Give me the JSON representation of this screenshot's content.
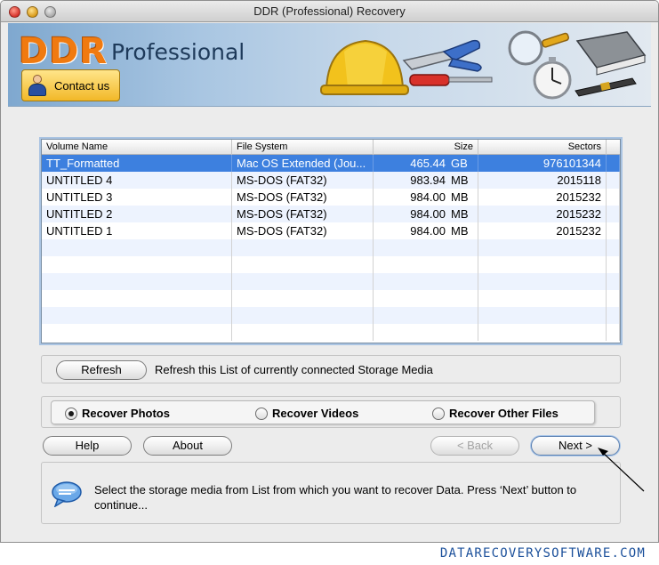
{
  "window": {
    "title": "DDR (Professional) Recovery"
  },
  "header": {
    "logo_main": "DDR",
    "logo_sub": "Professional",
    "contact_label": "Contact us"
  },
  "table": {
    "columns": [
      "Volume Name",
      "File System",
      "Size",
      "Sectors"
    ],
    "rows": [
      {
        "name": "TT_Formatted",
        "fs": "Mac OS Extended (Jou...",
        "size": "465.44",
        "unit": "GB",
        "sectors": "976101344",
        "selected": true
      },
      {
        "name": "UNTITLED 4",
        "fs": "MS-DOS (FAT32)",
        "size": "983.94",
        "unit": "MB",
        "sectors": "2015118"
      },
      {
        "name": "UNTITLED 3",
        "fs": "MS-DOS (FAT32)",
        "size": "984.00",
        "unit": "MB",
        "sectors": "2015232"
      },
      {
        "name": "UNTITLED 2",
        "fs": "MS-DOS (FAT32)",
        "size": "984.00",
        "unit": "MB",
        "sectors": "2015232"
      },
      {
        "name": "UNTITLED 1",
        "fs": "MS-DOS (FAT32)",
        "size": "984.00",
        "unit": "MB",
        "sectors": "2015232"
      }
    ]
  },
  "refresh": {
    "button_label": "Refresh",
    "description": "Refresh this List of currently connected Storage Media"
  },
  "recovery_mode": {
    "options": [
      "Recover Photos",
      "Recover Videos",
      "Recover Other Files"
    ],
    "selected": "Recover Photos"
  },
  "buttons": {
    "help": "Help",
    "about": "About",
    "back": "< Back",
    "next": "Next >"
  },
  "info": {
    "message": "Select the storage media from List from which you want to recover Data. Press ‘Next’ button to continue..."
  },
  "footer": {
    "url": "DATARECOVERYSOFTWARE.COM"
  },
  "colors": {
    "selection": "#3d80df",
    "logo_orange": "#f07a10",
    "footer_blue": "#1a4f9a"
  }
}
